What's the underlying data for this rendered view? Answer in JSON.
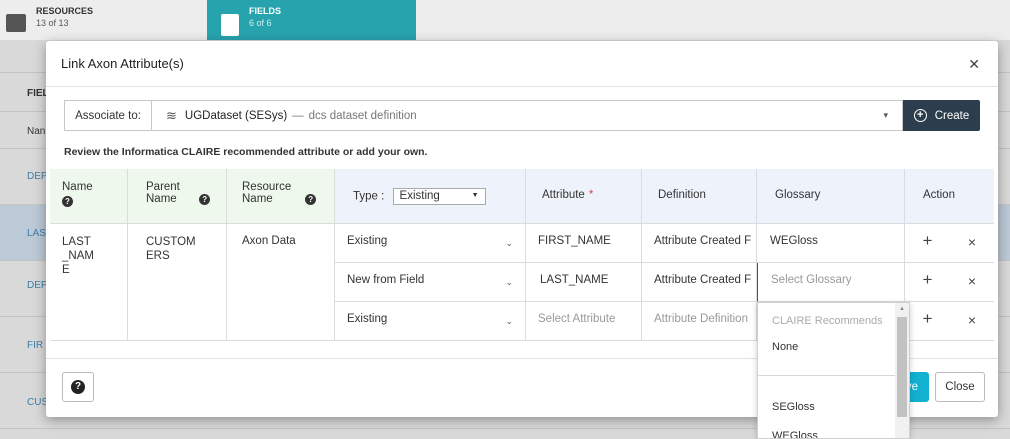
{
  "background": {
    "tabs": [
      {
        "label": "RESOURCES",
        "count": "13 of 13"
      },
      {
        "label": "FIELDS",
        "count": "6 of 6"
      }
    ],
    "section_header": "FIEL",
    "column_header": "Nan",
    "side_items": [
      "DEP",
      "LAS",
      "DEP",
      "FIR",
      "CUS"
    ]
  },
  "modal": {
    "title": "Link Axon Attribute(s)",
    "associate_label": "Associate to:",
    "associate_value": "UGDataset (SESys)",
    "associate_dash": "—",
    "associate_desc": "dcs dataset definition",
    "create_label": "Create",
    "review_text": "Review the Informatica CLAIRE recommended attribute or add your own.",
    "columns": {
      "name": "Name",
      "parent_name": "Parent Name",
      "resource_name": "Resource Name",
      "type_label": "Type :",
      "type_value": "Existing",
      "attribute": "Attribute",
      "required_mark": "*",
      "definition": "Definition",
      "glossary": "Glossary",
      "action": "Action"
    },
    "field": {
      "name": "LAST_NAME",
      "parent_name": "CUSTOMERS",
      "resource_name": "Axon Data"
    },
    "rows": [
      {
        "type": "Existing",
        "attribute": "FIRST_NAME",
        "definition": "Attribute Created F",
        "glossary": "WEGloss",
        "add": "+",
        "remove": "×"
      },
      {
        "type": "New from Field",
        "attribute": "LAST_NAME",
        "definition": "Attribute Created F",
        "glossary_placeholder": "Select Glossary",
        "add": "+",
        "remove": "×"
      },
      {
        "type": "Existing",
        "attribute_placeholder": "Select Attribute",
        "definition_placeholder": "Attribute Definition",
        "add": "+",
        "remove": "×"
      }
    ],
    "save_label": "Save",
    "close_label": "Close"
  },
  "glossary_dropdown": {
    "group_label": "CLAIRE Recommends",
    "options": [
      "None",
      "SEGloss",
      "WEGloss"
    ]
  },
  "icons": [
    "stack-icon",
    "plus-circle-icon",
    "question-icon",
    "chevron-down-icon",
    "close-icon",
    "plus-icon"
  ],
  "colors": {
    "fields_tab": "#27a3ad",
    "create_button": "#2c3e4d",
    "save_button": "#12b0d1",
    "required": "#e04040"
  }
}
